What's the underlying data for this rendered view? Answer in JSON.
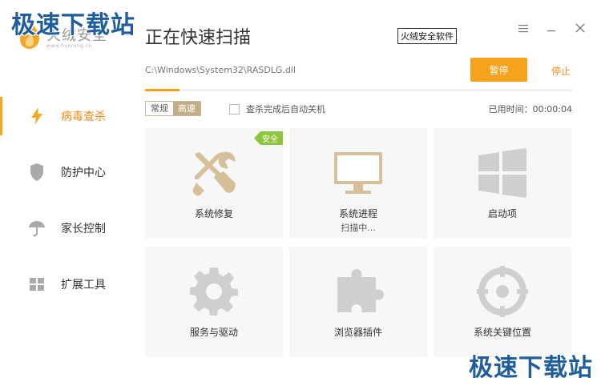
{
  "watermark": "极速下载站",
  "app": {
    "name": "火绒安全",
    "url": "www.huorong.cn",
    "title": "正在快速扫描",
    "brand_tag": "火绒安全软件"
  },
  "window_controls": [
    "menu-icon",
    "minimize-icon",
    "close-icon"
  ],
  "sidebar": {
    "items": [
      {
        "label": "病毒查杀",
        "icon": "lightning-icon",
        "active": true
      },
      {
        "label": "防护中心",
        "icon": "shield-icon",
        "active": false
      },
      {
        "label": "家长控制",
        "icon": "umbrella-icon",
        "active": false
      },
      {
        "label": "扩展工具",
        "icon": "grid-icon",
        "active": false
      }
    ]
  },
  "scan": {
    "current_path": "C:\\Windows\\System32\\RASDLG.dll",
    "pause_label": "暂停",
    "stop_label": "停止",
    "progress_fraction": 0.08,
    "mode_normal": "常规",
    "mode_fast": "高速",
    "auto_shutdown_label": "查杀完成后自动关机",
    "elapsed_label": "已用时间：00:00:04"
  },
  "cards": [
    {
      "label": "系统修复",
      "icon": "tools-icon",
      "tag": "安全",
      "sub": ""
    },
    {
      "label": "系统进程",
      "icon": "monitor-icon",
      "tag": "",
      "sub": "扫描中..."
    },
    {
      "label": "启动项",
      "icon": "windows-icon",
      "tag": "",
      "sub": ""
    },
    {
      "label": "服务与驱动",
      "icon": "gear-icon",
      "tag": "",
      "sub": ""
    },
    {
      "label": "浏览器插件",
      "icon": "puzzle-icon",
      "tag": "",
      "sub": ""
    },
    {
      "label": "系统关键位置",
      "icon": "target-icon",
      "tag": "",
      "sub": ""
    }
  ],
  "colors": {
    "accent": "#f7a21c",
    "icon_tan": "#d5c09a",
    "icon_gray": "#cfcfcf",
    "safe_green": "#8cc63f"
  }
}
